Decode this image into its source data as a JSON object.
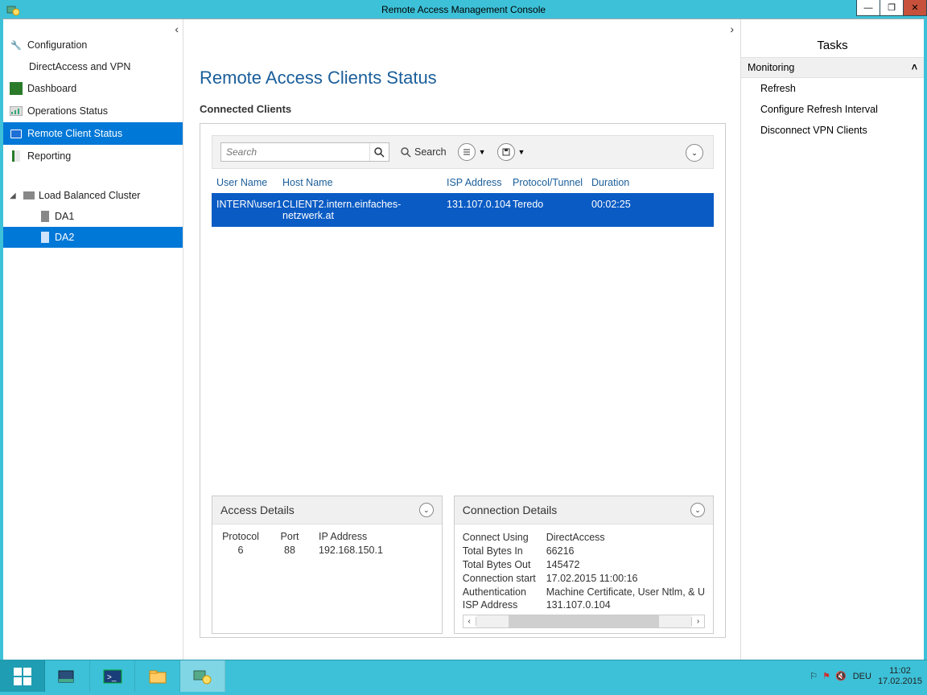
{
  "window": {
    "title": "Remote Access Management Console",
    "minimize": "—",
    "restore": "❐",
    "close": "✕"
  },
  "nav": {
    "items": [
      {
        "label": "Configuration",
        "icon": "wrench-icon"
      },
      {
        "label": "DirectAccess and VPN",
        "sub": true
      },
      {
        "label": "Dashboard",
        "icon": "dashboard-icon"
      },
      {
        "label": "Operations Status",
        "icon": "ops-icon"
      },
      {
        "label": "Remote Client Status",
        "icon": "monitor-icon",
        "selected": true
      },
      {
        "label": "Reporting",
        "icon": "report-icon"
      }
    ],
    "tree": {
      "root": "Load Balanced Cluster",
      "nodes": [
        {
          "label": "DA1"
        },
        {
          "label": "DA2",
          "selected": true
        }
      ]
    }
  },
  "content": {
    "title": "Remote Access Clients Status",
    "subtitle": "Connected Clients",
    "search": {
      "placeholder": "Search",
      "button_label": "Search"
    },
    "columns": [
      "User Name",
      "Host Name",
      "ISP Address",
      "Protocol/Tunnel",
      "Duration"
    ],
    "rows": [
      {
        "user": "INTERN\\user1",
        "host": "CLIENT2.intern.einfaches-netzwerk.at",
        "isp": "131.107.0.104",
        "proto": "Teredo",
        "dur": "00:02:25"
      }
    ],
    "access_details": {
      "title": "Access Details",
      "cols": [
        "Protocol",
        "Port",
        "IP Address"
      ],
      "row": {
        "protocol": "6",
        "port": "88",
        "ip": "192.168.150.1"
      }
    },
    "connection_details": {
      "title": "Connection Details",
      "rows": [
        {
          "label": "Connect Using",
          "value": "DirectAccess"
        },
        {
          "label": "Total Bytes In",
          "value": "66216"
        },
        {
          "label": "Total Bytes Out",
          "value": "145472"
        },
        {
          "label": "Connection start",
          "value": "17.02.2015 11:00:16"
        },
        {
          "label": "Authentication",
          "value": "Machine Certificate, User Ntlm, & U"
        },
        {
          "label": "ISP Address",
          "value": "131.107.0.104"
        }
      ]
    }
  },
  "tasks": {
    "title": "Tasks",
    "group": "Monitoring",
    "items": [
      "Refresh",
      "Configure Refresh Interval",
      "Disconnect VPN Clients"
    ]
  },
  "tray": {
    "lang": "DEU",
    "time": "11:02",
    "date": "17.02.2015"
  }
}
